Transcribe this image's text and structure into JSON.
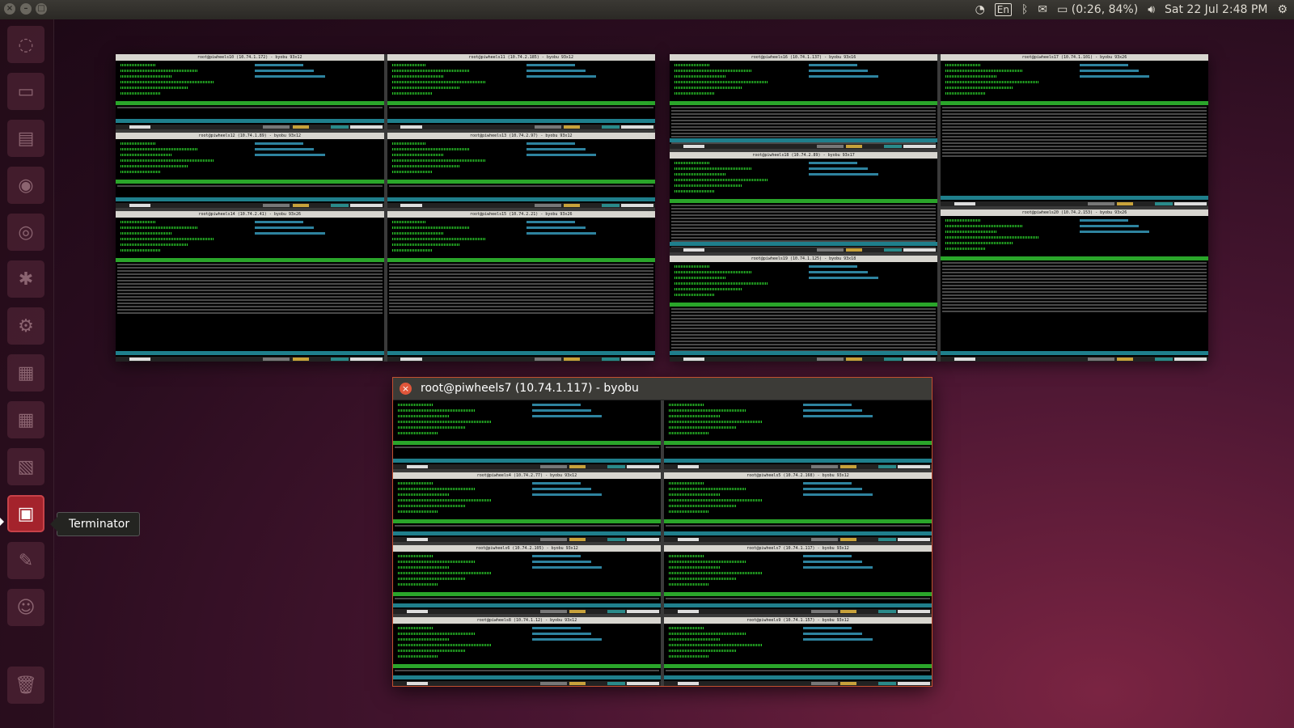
{
  "top_panel": {
    "keyboard_layout": "En",
    "battery": "(0:26, 84%)",
    "datetime": "Sat 22 Jul  2:48 PM",
    "icons": [
      "wifi-icon",
      "keyboard-icon",
      "bluetooth-icon",
      "mail-icon",
      "battery-icon",
      "volume-icon",
      "gear-icon"
    ]
  },
  "launcher": {
    "items": [
      {
        "name": "dash-icon",
        "glyph": "◌"
      },
      {
        "name": "terminal-icon",
        "glyph": "▭"
      },
      {
        "name": "files-icon",
        "glyph": "▤"
      },
      {
        "name": "firefox-icon",
        "glyph": "◉"
      },
      {
        "name": "chrome-icon",
        "glyph": "◎"
      },
      {
        "name": "settings-app-icon",
        "glyph": "✱"
      },
      {
        "name": "system-icon",
        "glyph": "⚙"
      },
      {
        "name": "writer-icon",
        "glyph": "▦"
      },
      {
        "name": "calc-icon",
        "glyph": "▦"
      },
      {
        "name": "impress-icon",
        "glyph": "▧"
      },
      {
        "name": "terminator-icon",
        "glyph": "▣"
      },
      {
        "name": "gimp-icon",
        "glyph": "✎"
      },
      {
        "name": "pidgin-icon",
        "glyph": "☺"
      },
      {
        "name": "trash-icon",
        "glyph": "🗑"
      }
    ],
    "tooltip": "Terminator"
  },
  "windows": [
    {
      "panes": [
        "root@piwheels10 (10.74.1.172) - byobu 93x12",
        "root@piwheels11 (10.74.2.185) - byobu 93x12",
        "root@piwheels12 (10.74.1.89) - byobu 93x12",
        "root@piwheels13 (10.74.2.97) - byobu 93x12",
        "root@piwheels14 (10.74.2.41) - byobu 93x26",
        "root@piwheels15 (10.74.2.21) - byobu 93x26"
      ]
    },
    {
      "panes": [
        "root@piwheels16 (10.74.1.137) - byobu 93x16",
        "root@piwheels17 (10.74.1.101) - byobu 93x26",
        "root@piwheels18 (10.74.2.89) - byobu 93x17",
        "root@piwheels19 (10.74.1.125) - byobu 93x18",
        "root@piwheels20 (10.74.2.153) - byobu 93x26"
      ]
    }
  ],
  "focus_window": {
    "title": "root@piwheels7 (10.74.1.117) - byobu",
    "panes": [
      "",
      "",
      "root@piwheels4 (10.74.2.77) - byobu 93x12",
      "root@piwheels5 (10.74.2.168) - byobu 93x12",
      "root@piwheels6 (10.74.2.105) - byobu 93x12",
      "root@piwheels7 (10.74.1.117) - byobu 93x12",
      "root@piwheels8 (10.74.1.12) - byobu 93x12",
      "root@piwheels9 (10.74.1.157) - byobu 93x12"
    ]
  }
}
